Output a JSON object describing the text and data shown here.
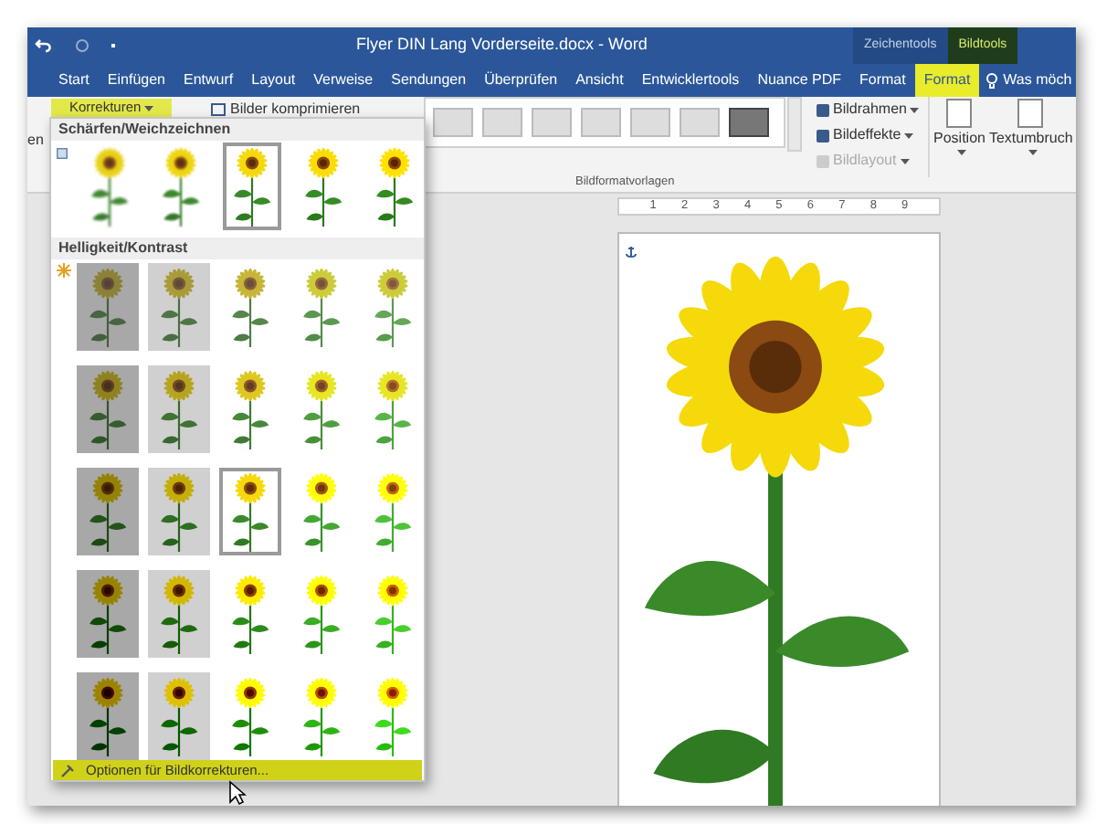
{
  "title_bar": {
    "title": "Flyer DIN Lang Vorderseite.docx - Word",
    "context_groups": [
      {
        "label": "Zeichentools",
        "selected": false
      },
      {
        "label": "Bildtools",
        "selected": true
      }
    ]
  },
  "tabs": [
    {
      "label": "Start",
      "selected": false
    },
    {
      "label": "Einfügen",
      "selected": false
    },
    {
      "label": "Entwurf",
      "selected": false
    },
    {
      "label": "Layout",
      "selected": false
    },
    {
      "label": "Verweise",
      "selected": false
    },
    {
      "label": "Sendungen",
      "selected": false
    },
    {
      "label": "Überprüfen",
      "selected": false
    },
    {
      "label": "Ansicht",
      "selected": false
    },
    {
      "label": "Entwicklertools",
      "selected": false
    },
    {
      "label": "Nuance PDF",
      "selected": false
    },
    {
      "label": "Format",
      "selected": false
    },
    {
      "label": "Format",
      "selected": true
    }
  ],
  "tell_me": {
    "placeholder": "Was möch"
  },
  "ribbon": {
    "cut_label": "en",
    "corrections_button": "Korrekturen",
    "compress_button": "Bilder komprimieren",
    "styles_group_label": "Bildformatvorlagen",
    "commands": [
      {
        "label": "Bildrahmen",
        "disabled": false
      },
      {
        "label": "Bildeffekte",
        "disabled": false
      },
      {
        "label": "Bildlayout",
        "disabled": true
      }
    ],
    "position_button": "Position",
    "wrap_button": "Textumbruch"
  },
  "ruler": {
    "labels": [
      "1",
      "2",
      "3",
      "4",
      "5",
      "6",
      "7",
      "8",
      "9"
    ]
  },
  "corrections_menu": {
    "sharpen": {
      "title": "Schärfen/Weichzeichnen",
      "items": [
        {
          "selected": false
        },
        {
          "selected": false
        },
        {
          "selected": true
        },
        {
          "selected": false
        },
        {
          "selected": false
        }
      ]
    },
    "brightness": {
      "title": "Helligkeit/Kontrast",
      "rows": [
        [
          {
            "selected": false
          },
          {
            "selected": false
          },
          {
            "selected": false
          },
          {
            "selected": false
          },
          {
            "selected": false
          }
        ],
        [
          {
            "selected": false
          },
          {
            "selected": false
          },
          {
            "selected": false
          },
          {
            "selected": false
          },
          {
            "selected": false
          }
        ],
        [
          {
            "selected": false
          },
          {
            "selected": false
          },
          {
            "selected": true
          },
          {
            "selected": false
          },
          {
            "selected": false
          }
        ],
        [
          {
            "selected": false
          },
          {
            "selected": false
          },
          {
            "selected": false
          },
          {
            "selected": false
          },
          {
            "selected": false
          }
        ],
        [
          {
            "selected": false
          },
          {
            "selected": false
          },
          {
            "selected": false
          },
          {
            "selected": false
          },
          {
            "selected": false
          }
        ]
      ]
    },
    "options_item": "Optionen für Bildkorrekturen..."
  }
}
